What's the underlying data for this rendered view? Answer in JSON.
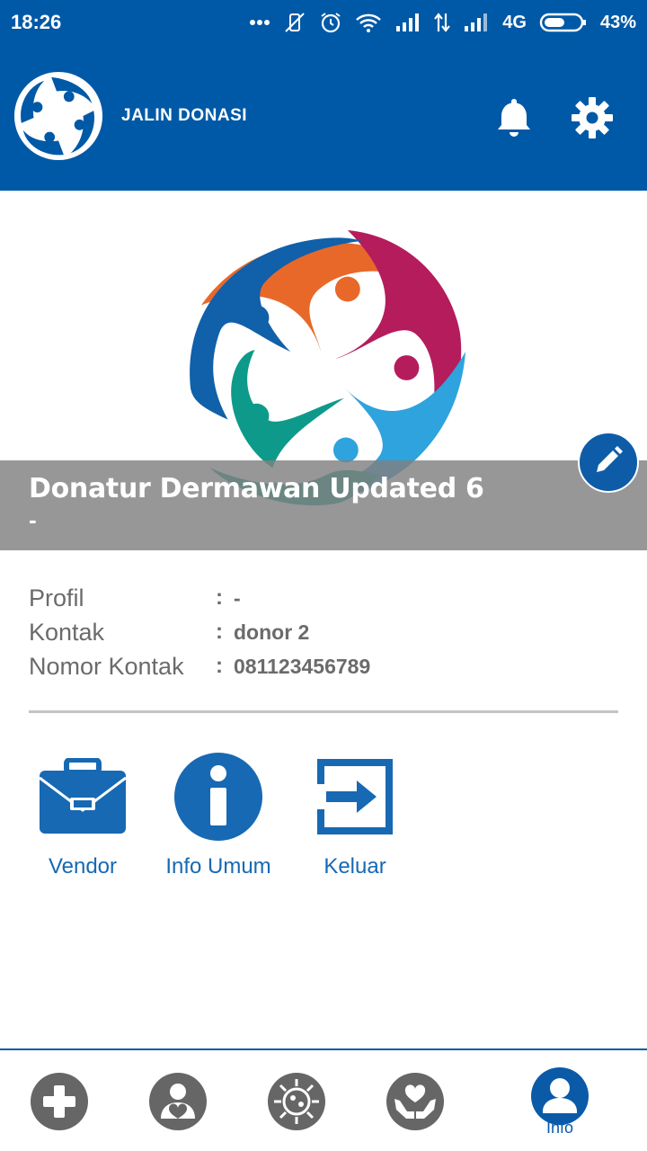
{
  "status_bar": {
    "time": "18:26",
    "network": "4G",
    "battery": "43%"
  },
  "app_bar": {
    "title": "JALIN DONASI",
    "logo_icon": "jalin-donasi-logo",
    "notification_icon": "bell-icon",
    "settings_icon": "gear-icon"
  },
  "profile": {
    "name": "Donatur Dermawan Updated 6",
    "subtitle": "-",
    "edit_icon": "pencil-icon",
    "fields": [
      {
        "label": "Profil",
        "value": "-"
      },
      {
        "label": "Kontak",
        "value": "donor 2"
      },
      {
        "label": "Nomor Kontak",
        "value": "081123456789"
      }
    ],
    "colon": ":"
  },
  "menu": {
    "items": [
      {
        "label": "Vendor",
        "icon": "briefcase-icon"
      },
      {
        "label": "Info Umum",
        "icon": "info-icon"
      },
      {
        "label": "Keluar",
        "icon": "logout-icon"
      }
    ]
  },
  "bottom_nav": {
    "items": [
      {
        "icon": "plus-icon"
      },
      {
        "icon": "person-heart-icon"
      },
      {
        "icon": "virus-icon"
      },
      {
        "icon": "hands-heart-icon"
      },
      {
        "icon": "user-icon",
        "label": "Info",
        "active": true
      }
    ]
  },
  "colors": {
    "primary": "#0059a7",
    "menu_label": "#1769b3",
    "nav_inactive": "#666666",
    "logo_orange": "#e8682a",
    "logo_magenta": "#b51c5c",
    "logo_lightblue": "#2ea3dd",
    "logo_teal": "#0e9a8a",
    "logo_blue": "#1060aa"
  }
}
